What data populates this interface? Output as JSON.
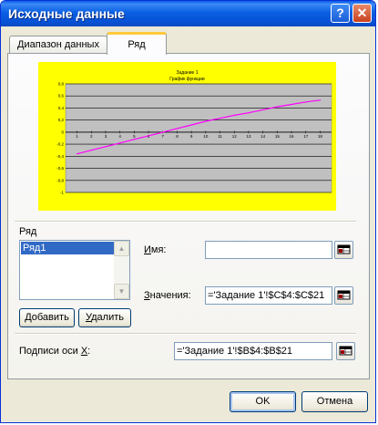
{
  "window": {
    "title": "Исходные данные"
  },
  "titlebar": {
    "help_label": "?",
    "close_label": "✕"
  },
  "tabs": [
    {
      "label": "Диапазон данных",
      "active": false
    },
    {
      "label": "Ряд",
      "active": true
    }
  ],
  "chart_data": {
    "type": "line",
    "title": "Задание 1",
    "subtitle": "График функции",
    "x": [
      1,
      2,
      3,
      4,
      5,
      6,
      7,
      8,
      9,
      10,
      11,
      12,
      13,
      14,
      15,
      16,
      17,
      18
    ],
    "series": [
      {
        "values": [
          -0.36,
          -0.3,
          -0.24,
          -0.18,
          -0.12,
          -0.06,
          0.0,
          0.06,
          0.12,
          0.18,
          0.23,
          0.28,
          0.32,
          0.37,
          0.42,
          0.46,
          0.5,
          0.53
        ],
        "color": "#ff00ff"
      }
    ],
    "yticks": [
      "0,8",
      "0,6",
      "0,4",
      "0,2",
      "0",
      "-0,2",
      "-0,4",
      "-0,6",
      "-0,8",
      "-1"
    ],
    "ylim": [
      -1,
      0.8
    ],
    "grid": true,
    "plot_background": "#c0c0c0",
    "chart_background": "#ffff00"
  },
  "series_group": {
    "label": "Ряд",
    "items": [
      "Ряд1"
    ],
    "scroll_up_icon": "triangle-up-icon",
    "scroll_down_icon": "triangle-down-icon",
    "add_label_u": "Д",
    "add_label_rest": "обавить",
    "remove_label_u": "У",
    "remove_label_rest": "далить"
  },
  "fields": {
    "name_label_u": "И",
    "name_label_rest": "мя:",
    "name_value": "",
    "values_label_u": "З",
    "values_label_rest": "начения:",
    "values_value": "='Задание 1'!$C$4:$C$21",
    "xaxis_label_prefix": "Подписи оси ",
    "xaxis_label_u": "X",
    "xaxis_label_suffix": ":",
    "xaxis_value": "='Задание 1'!$B$4:$B$21",
    "ref_icon": "range-selector-icon"
  },
  "footer": {
    "ok_label": "OK",
    "cancel_label": "Отмена"
  },
  "colors": {
    "title_bar": "#0b5fe3",
    "selection": "#316ac5",
    "tab_accent": "#ffc83c"
  }
}
